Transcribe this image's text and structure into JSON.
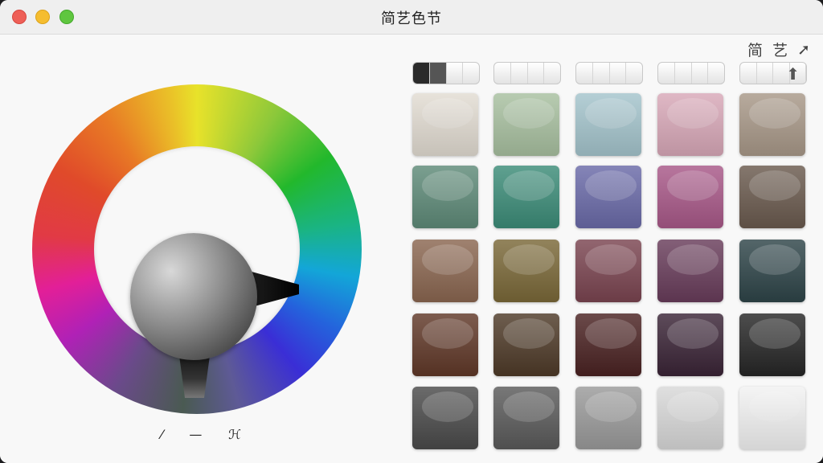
{
  "window": {
    "title": "简艺色节"
  },
  "corner_tools": [
    {
      "name": "tool-char-jian",
      "glyph": "简"
    },
    {
      "name": "tool-char-yi",
      "glyph": "艺"
    },
    {
      "name": "expand-arrow-icon",
      "glyph": "➚"
    }
  ],
  "wheel_tools": [
    {
      "name": "eyedropper-icon",
      "glyph": "⁄"
    },
    {
      "name": "dash-icon",
      "glyph": "—"
    },
    {
      "name": "tool-glyph-icon",
      "glyph": "ℋ"
    }
  ],
  "palette_tabs": [
    {
      "name": "palette-tab-1",
      "active": true
    },
    {
      "name": "palette-tab-2",
      "active": false
    },
    {
      "name": "palette-tab-3",
      "active": false
    },
    {
      "name": "palette-tab-4",
      "active": false
    },
    {
      "name": "palette-tab-5",
      "active": false,
      "icon": "up-arrow-icon",
      "glyph": "⬆"
    }
  ],
  "swatches": [
    [
      "#e2dcd2",
      "#a8c0a0",
      "#a4c4cc",
      "#d8a8b8",
      "#a89888"
    ],
    [
      "#5e8a78",
      "#3c8c78",
      "#6a6aa8",
      "#a85888",
      "#6a5a4e"
    ],
    [
      "#8a6650",
      "#7a6838",
      "#7a4450",
      "#683c5a",
      "#2e4448"
    ],
    [
      "#603828",
      "#4e3a28",
      "#4a2222",
      "#3a2436",
      "#262626"
    ],
    [
      "#4a4a4a",
      "#5a5a5a",
      "#9a9a9a",
      "#d8d8d8",
      "#f2f2f2"
    ]
  ]
}
